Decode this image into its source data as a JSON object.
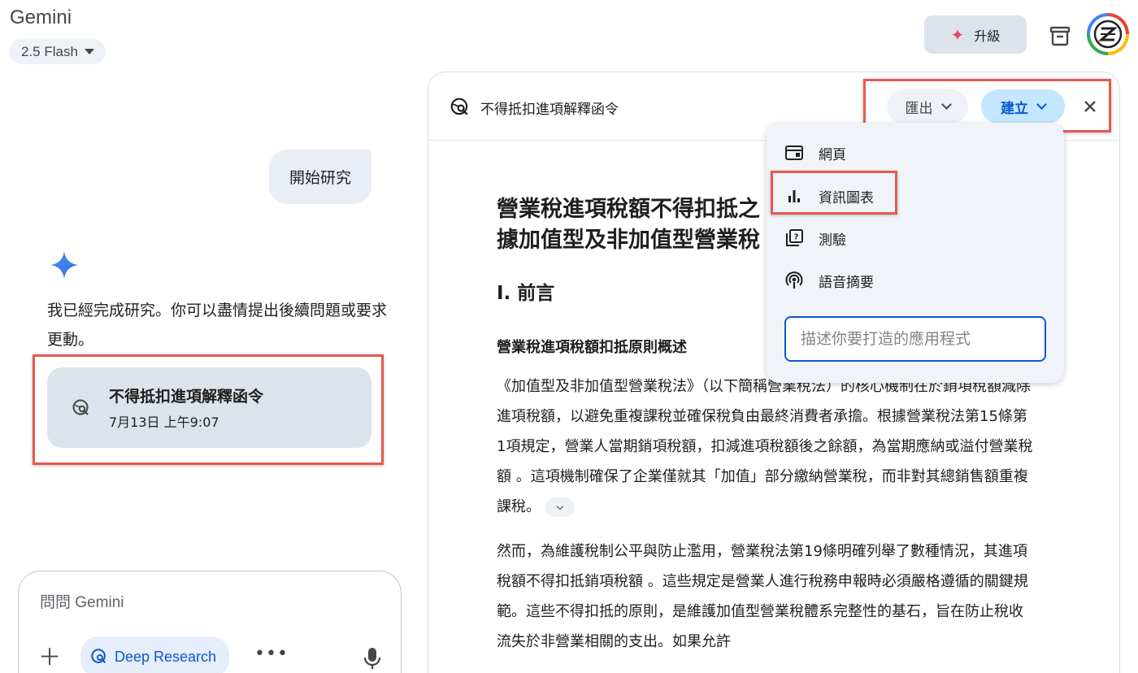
{
  "app": {
    "title": "Gemini",
    "model": "2.5 Flash"
  },
  "topbar": {
    "upgrade_label": "升級"
  },
  "chat": {
    "user_message": "開始研究",
    "assistant_reply": "我已經完成研究。你可以盡情提出後續問題或要求更動。",
    "research_card": {
      "title": "不得抵扣進項解釋函令",
      "date": "7月13日 上午9:07"
    }
  },
  "composer": {
    "placeholder": "問問 Gemini",
    "deep_research_label": "Deep Research",
    "more_label": "•••"
  },
  "doc": {
    "header_title": "不得抵扣進項解釋函令",
    "export_label": "匯出",
    "create_label": "建立",
    "h1_line1": "營業稅進項稅額不得扣抵之",
    "h1_line2": "據加值型及非加值型營業稅",
    "h2": "I. 前言",
    "h3": "營業稅進項稅額扣抵原則概述",
    "p1": "《加值型及非加值型營業稅法》（以下簡稱營業稅法）的核心機制在於銷項稅額減除進項稅額，以避免重複課稅並確保稅負由最終消費者承擔。根據營業稅法第15條第1項規定，營業人當期銷項稅額，扣減進項稅額後之餘額，為當期應納或溢付營業稅額 。這項機制確保了企業僅就其「加值」部分繳納營業稅，而非對其總銷售額重複課稅。",
    "p2": "然而，為維護稅制公平與防止濫用，營業稅法第19條明確列舉了數種情況，其進項稅額不得扣抵銷項稅額 。這些規定是營業人進行稅務申報時必須嚴格遵循的關鍵規範。這些不得扣抵的原則，是維護加值型營業稅體系完整性的基石，旨在防止稅收流失於非營業相關的支出。如果允許"
  },
  "create_menu": {
    "items": [
      {
        "label": "網頁",
        "icon": "web-page-icon"
      },
      {
        "label": "資訊圖表",
        "icon": "bar-chart-icon"
      },
      {
        "label": "測驗",
        "icon": "quiz-icon"
      },
      {
        "label": "語音摘要",
        "icon": "podcast-icon"
      }
    ],
    "input_placeholder": "描述你要打造的應用程式"
  },
  "colors": {
    "accent": "#0b57d0",
    "highlight": "#e45a4f",
    "create_bg": "#c2e7ff",
    "card_bg": "#dde3ea"
  }
}
